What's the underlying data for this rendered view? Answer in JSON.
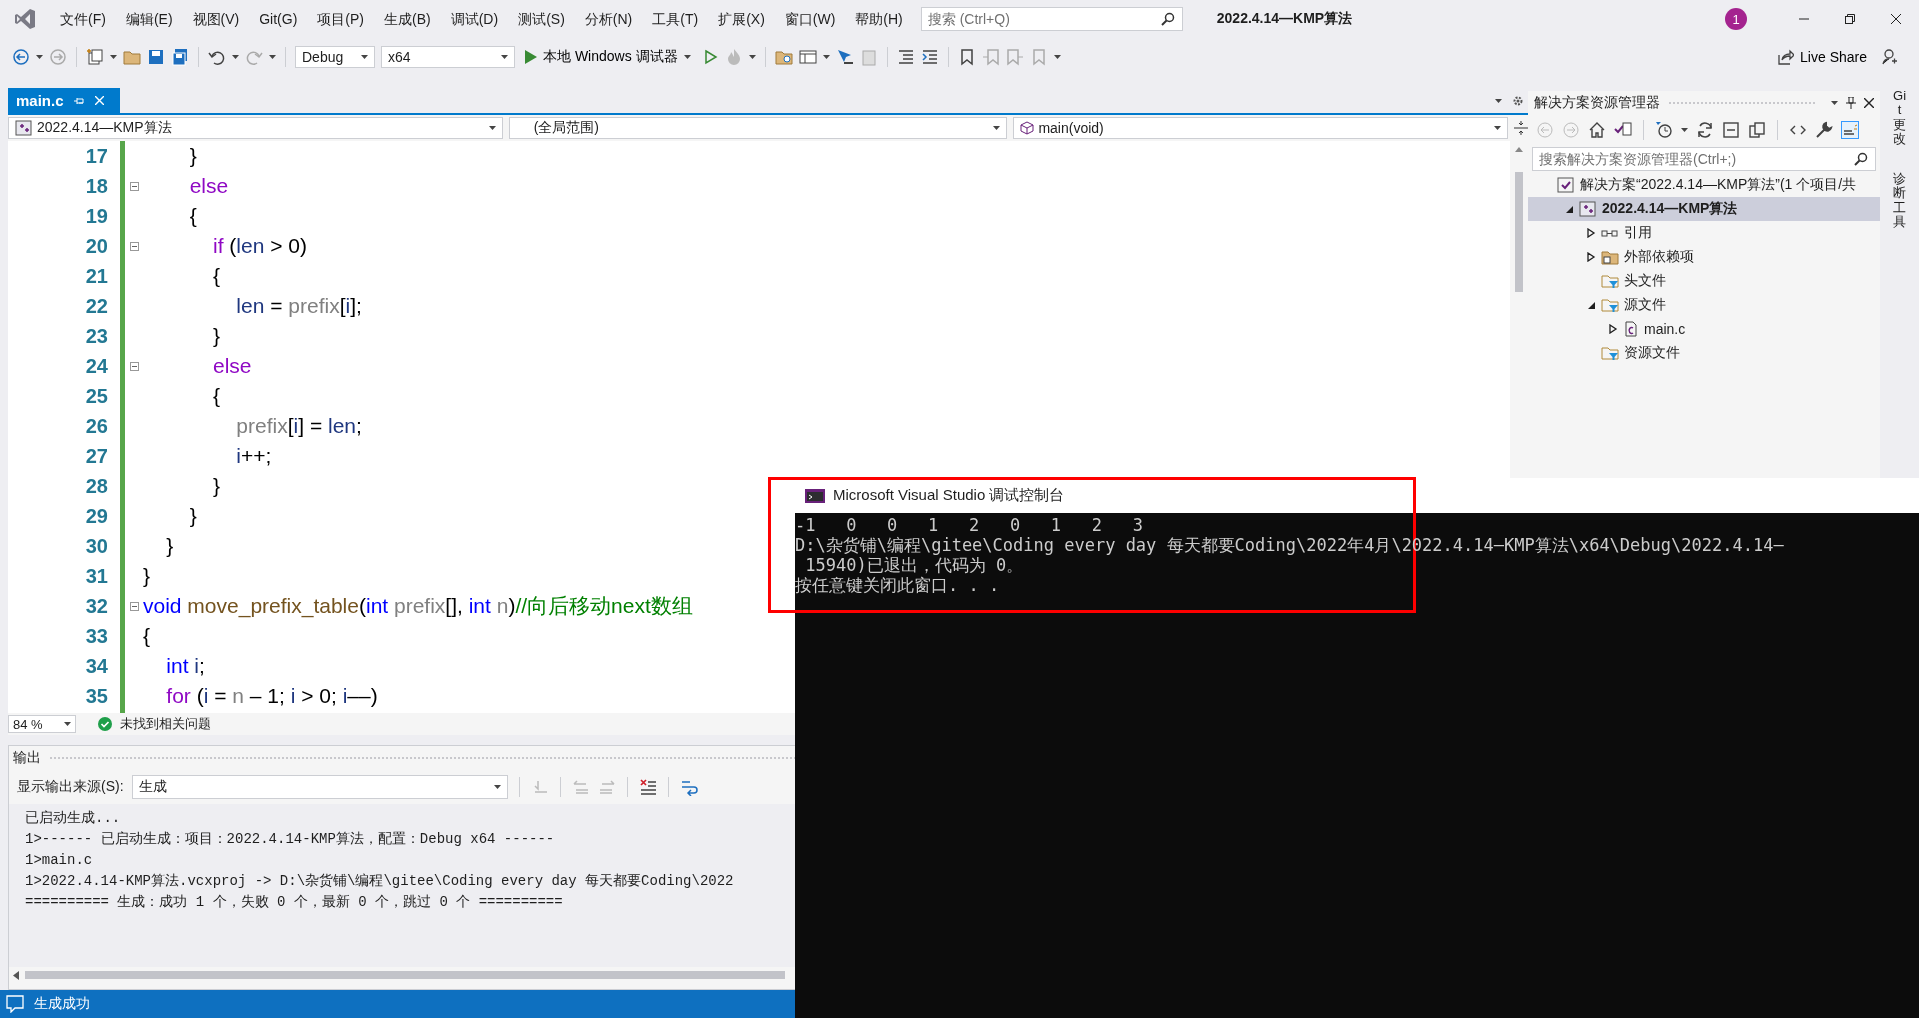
{
  "window": {
    "title": "2022.4.14—KMP算法",
    "notification_count": "1"
  },
  "menu": [
    "文件(F)",
    "编辑(E)",
    "视图(V)",
    "Git(G)",
    "项目(P)",
    "生成(B)",
    "调试(D)",
    "测试(S)",
    "分析(N)",
    "工具(T)",
    "扩展(X)",
    "窗口(W)",
    "帮助(H)"
  ],
  "search": {
    "placeholder": "搜索 (Ctrl+Q)"
  },
  "toolbar": {
    "configuration": "Debug",
    "platform": "x64",
    "run_target": "本地 Windows 调试器",
    "live_share": "Live Share"
  },
  "editor": {
    "tabs": [
      {
        "label": "main.c",
        "selected": true
      }
    ],
    "nav": {
      "project": "2022.4.14—KMP算法",
      "scope": "(全局范围)",
      "member": "main(void)"
    },
    "lines": [
      {
        "number": "17",
        "fold": false,
        "tokens": [
          {
            "text": "        }",
            "kind": "plain"
          }
        ]
      },
      {
        "number": "18",
        "fold": true,
        "tokens": [
          {
            "text": "        else",
            "kind": "keyword"
          }
        ]
      },
      {
        "number": "19",
        "fold": false,
        "tokens": [
          {
            "text": "        {",
            "kind": "plain"
          }
        ]
      },
      {
        "number": "20",
        "fold": true,
        "tokens": [
          {
            "text": "            if",
            "kind": "keyword"
          },
          {
            "text": " (",
            "kind": "plain"
          },
          {
            "text": "len",
            "kind": "local"
          },
          {
            "text": " > 0)",
            "kind": "plain"
          }
        ]
      },
      {
        "number": "21",
        "fold": false,
        "tokens": [
          {
            "text": "            {",
            "kind": "plain"
          }
        ]
      },
      {
        "number": "22",
        "fold": false,
        "tokens": [
          {
            "text": "                len",
            "kind": "local"
          },
          {
            "text": " = ",
            "kind": "plain"
          },
          {
            "text": "prefix",
            "kind": "param"
          },
          {
            "text": "[",
            "kind": "plain"
          },
          {
            "text": "i",
            "kind": "local"
          },
          {
            "text": "];",
            "kind": "plain"
          }
        ]
      },
      {
        "number": "23",
        "fold": false,
        "tokens": [
          {
            "text": "            }",
            "kind": "plain"
          }
        ]
      },
      {
        "number": "24",
        "fold": true,
        "tokens": [
          {
            "text": "            else",
            "kind": "keyword"
          }
        ]
      },
      {
        "number": "25",
        "fold": false,
        "tokens": [
          {
            "text": "            {",
            "kind": "plain"
          }
        ]
      },
      {
        "number": "26",
        "fold": false,
        "tokens": [
          {
            "text": "                prefix",
            "kind": "param"
          },
          {
            "text": "[",
            "kind": "plain"
          },
          {
            "text": "i",
            "kind": "local"
          },
          {
            "text": "] = ",
            "kind": "plain"
          },
          {
            "text": "len",
            "kind": "local"
          },
          {
            "text": ";",
            "kind": "plain"
          }
        ]
      },
      {
        "number": "27",
        "fold": false,
        "tokens": [
          {
            "text": "                i",
            "kind": "local"
          },
          {
            "text": "++;",
            "kind": "plain"
          }
        ]
      },
      {
        "number": "28",
        "fold": false,
        "tokens": [
          {
            "text": "            }",
            "kind": "plain"
          }
        ]
      },
      {
        "number": "29",
        "fold": false,
        "tokens": [
          {
            "text": "        }",
            "kind": "plain"
          }
        ]
      },
      {
        "number": "30",
        "fold": false,
        "tokens": [
          {
            "text": "    }",
            "kind": "plain"
          }
        ]
      },
      {
        "number": "31",
        "fold": false,
        "tokens": [
          {
            "text": "}",
            "kind": "plain"
          }
        ]
      },
      {
        "number": "32",
        "fold": true,
        "tokens": [
          {
            "text": "void ",
            "kind": "type"
          },
          {
            "text": "move_prefix_table",
            "kind": "function"
          },
          {
            "text": "(",
            "kind": "plain"
          },
          {
            "text": "int",
            "kind": "type"
          },
          {
            "text": " prefix",
            "kind": "param"
          },
          {
            "text": "[], ",
            "kind": "plain"
          },
          {
            "text": "int",
            "kind": "type"
          },
          {
            "text": " n",
            "kind": "param"
          },
          {
            "text": ")",
            "kind": "plain"
          },
          {
            "text": "//向后移动next数组",
            "kind": "comment"
          }
        ]
      },
      {
        "number": "33",
        "fold": false,
        "tokens": [
          {
            "text": "{",
            "kind": "plain"
          }
        ]
      },
      {
        "number": "34",
        "fold": false,
        "tokens": [
          {
            "text": "    int ",
            "kind": "type"
          },
          {
            "text": "i",
            "kind": "local"
          },
          {
            "text": ";",
            "kind": "plain"
          }
        ]
      },
      {
        "number": "35",
        "fold": false,
        "tokens": [
          {
            "text": "    for",
            "kind": "keyword"
          },
          {
            "text": " (",
            "kind": "plain"
          },
          {
            "text": "i",
            "kind": "local"
          },
          {
            "text": " = ",
            "kind": "plain"
          },
          {
            "text": "n",
            "kind": "param"
          },
          {
            "text": " – 1; ",
            "kind": "plain"
          },
          {
            "text": "i",
            "kind": "local"
          },
          {
            "text": " > 0; ",
            "kind": "plain"
          },
          {
            "text": "i",
            "kind": "local"
          },
          {
            "text": "––)",
            "kind": "plain"
          }
        ]
      }
    ],
    "zoom": "84 %",
    "issues": "未找到相关问题"
  },
  "output": {
    "title": "输出",
    "source_label": "显示输出来源(S):",
    "source": "生成",
    "lines": [
      "已启动生成...",
      "1>------ 已启动生成：项目：2022.4.14-KMP算法，配置：Debug x64 ------",
      "1>main.c",
      "1>2022.4.14-KMP算法.vcxproj -> D:\\杂货铺\\编程\\gitee\\Coding every day 每天都要Coding\\2022",
      "========== 生成：成功 1 个，失败 0 个，最新 0 个，跳过 0 个 =========="
    ]
  },
  "solution_explorer": {
    "title": "解决方案资源管理器",
    "search_placeholder": "搜索解决方案资源管理器(Ctrl+;)",
    "tree": [
      {
        "label": "解决方案“2022.4.14—KMP算法”(1 个项目/共",
        "kind": "solution",
        "expandable": false,
        "expanded": true,
        "selected": false,
        "children": [
          {
            "label": "2022.4.14—KMP算法",
            "kind": "project",
            "expandable": true,
            "expanded": true,
            "selected": true,
            "children": [
              {
                "label": "引用",
                "kind": "references",
                "expandable": true,
                "expanded": false,
                "selected": false
              },
              {
                "label": "外部依赖项",
                "kind": "external",
                "expandable": true,
                "expanded": false,
                "selected": false
              },
              {
                "label": "头文件",
                "kind": "filter",
                "expandable": false,
                "selected": false
              },
              {
                "label": "源文件",
                "kind": "filter",
                "expandable": true,
                "expanded": true,
                "selected": false,
                "children": [
                  {
                    "label": "main.c",
                    "kind": "c-file",
                    "expandable": true,
                    "expanded": false,
                    "selected": false
                  }
                ]
              },
              {
                "label": "资源文件",
                "kind": "filter",
                "expandable": false,
                "selected": false
              }
            ]
          }
        ]
      }
    ]
  },
  "side_tabs": [
    "Git 更改",
    "诊断工具"
  ],
  "console": {
    "title": "Microsoft Visual Studio 调试控制台",
    "lines": [
      "-1   0   0   1   2   0   1   2   3",
      "D:\\杂货铺\\编程\\gitee\\Coding every day 每天都要Coding\\2022年4月\\2022.4.14—KMP算法\\x64\\Debug\\2022.4.14—",
      " 15940)已退出，代码为 0。",
      "按任意键关闭此窗口. . ."
    ]
  },
  "status_bar": {
    "message": "生成成功"
  }
}
